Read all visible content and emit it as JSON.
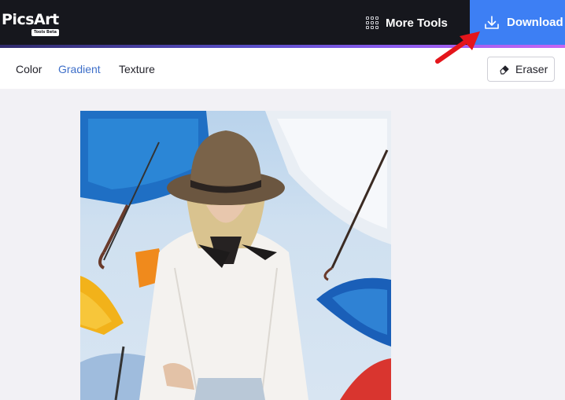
{
  "header": {
    "logo_text": "PicsArt",
    "logo_badge": "Tools Beta",
    "more_tools_label": "More Tools",
    "download_label": "Download"
  },
  "toolbar": {
    "tabs": [
      {
        "label": "Color",
        "active": false
      },
      {
        "label": "Gradient",
        "active": true
      },
      {
        "label": "Texture",
        "active": false
      }
    ],
    "eraser_label": "Eraser"
  },
  "colors": {
    "header_bg": "#16171d",
    "download_bg": "#3d7ff4",
    "active_tab": "#3e6fc9",
    "arrow": "#e4151b",
    "page_bg": "#f2f1f5"
  },
  "icons": [
    "grid-icon",
    "download-icon",
    "eraser-icon",
    "arrow-annotation"
  ]
}
